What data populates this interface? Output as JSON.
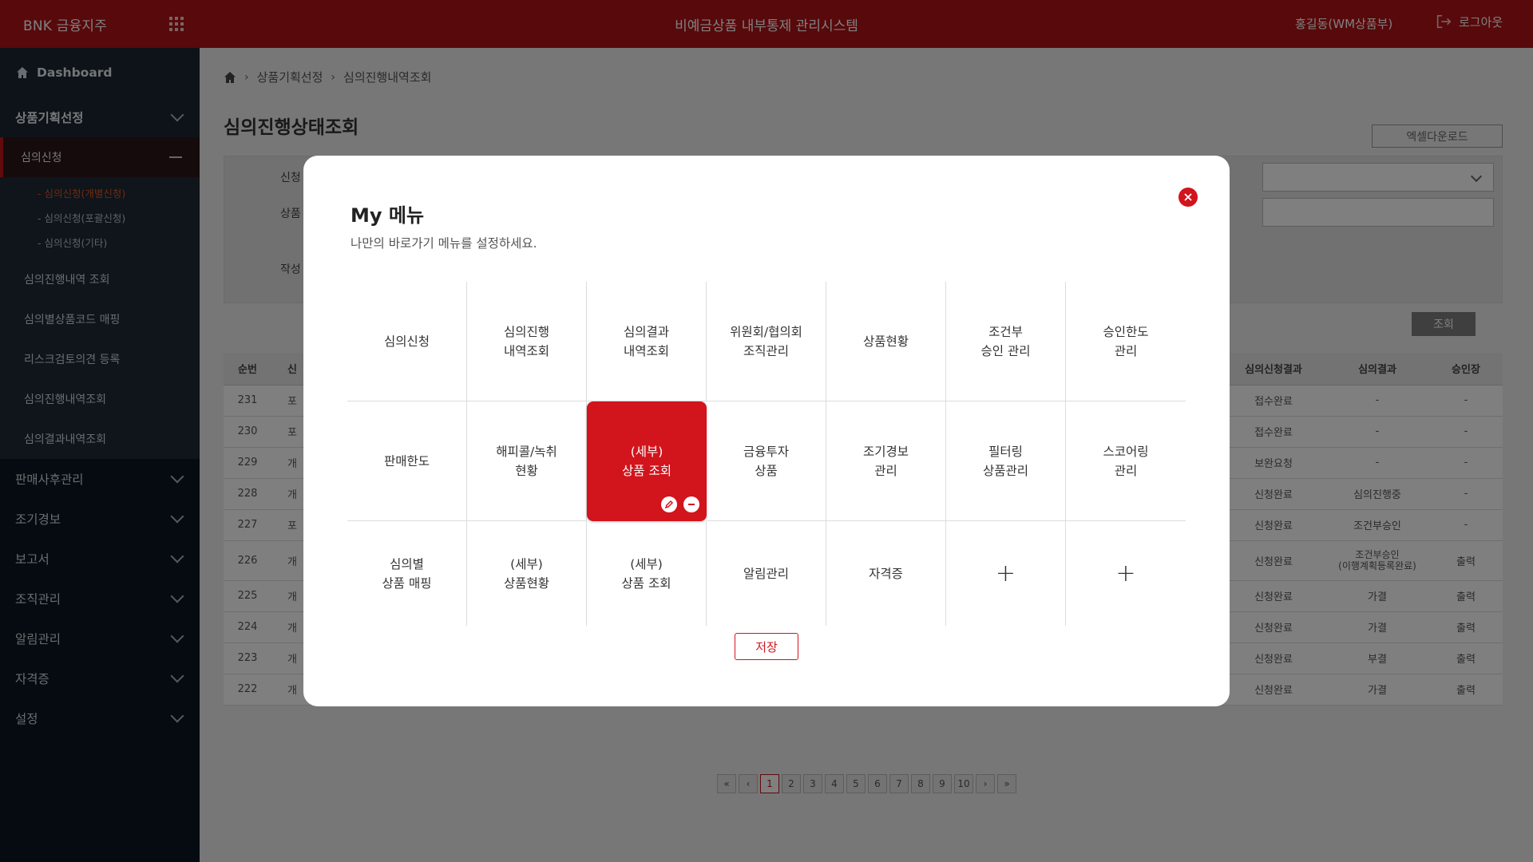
{
  "header": {
    "brand": "BNK 금융지주",
    "system_title": "비예금상품 내부통제 관리시스템",
    "user": "홍길동(WM상품부)",
    "logout_label": "로그아웃"
  },
  "sidebar": {
    "dashboard": "Dashboard",
    "section_open": "상품기획선정",
    "active_sub": "심의신청",
    "sub2": [
      "- 심의신청(개별신청)",
      "- 심의신청(포괄신청)",
      "- 심의신청(기타)"
    ],
    "items": [
      "심의진행내역 조회",
      "심의별상품코드 매핑",
      "리스크검토의견 등록",
      "심의진행내역조회",
      "심의결과내역조회"
    ],
    "sections": [
      "판매사후관리",
      "조기경보",
      "보고서",
      "조직관리",
      "알림관리",
      "자격증",
      "설정"
    ]
  },
  "main": {
    "breadcrumb": [
      "상품기획선정",
      "심의진행내역조회"
    ],
    "title": "심의진행상태조회",
    "excel_button": "엑셀다운로드",
    "search_labels": [
      "신청",
      "상품",
      "작성"
    ],
    "search_button": "조회",
    "table": {
      "headers": [
        "순번",
        "신",
        "심의신청결과",
        "심의결과",
        "승인장"
      ],
      "rows": [
        [
          "231",
          "포",
          "접수완료",
          "-",
          "-"
        ],
        [
          "230",
          "포",
          "접수완료",
          "-",
          "-"
        ],
        [
          "229",
          "개",
          "보완요청",
          "-",
          "-"
        ],
        [
          "228",
          "개",
          "신청완료",
          "심의진행중",
          "-"
        ],
        [
          "227",
          "포",
          "신청완료",
          "조건부승인",
          "-"
        ],
        [
          "226",
          "개",
          "신청완료",
          "조건부승인\n(이행계획등록완료)",
          "출력"
        ],
        [
          "225",
          "개",
          "신청완료",
          "가결",
          "출력"
        ],
        [
          "224",
          "개",
          "신청완료",
          "가결",
          "출력"
        ],
        [
          "223",
          "개",
          "신청완료",
          "부결",
          "출력"
        ],
        [
          "222",
          "개",
          "신청완료",
          "가결",
          "출력"
        ]
      ]
    },
    "pagination": [
      "«",
      "‹",
      "1",
      "2",
      "3",
      "4",
      "5",
      "6",
      "7",
      "8",
      "9",
      "10",
      "›",
      "»"
    ],
    "current_page": "1"
  },
  "modal": {
    "title": "My 메뉴",
    "subtitle": "나만의 바로가기 메뉴를 설정하세요.",
    "cells": [
      "심의신청",
      "심의진행\n내역조회",
      "심의결과\n내역조회",
      "위원회/협의회\n조직관리",
      "상품현황",
      "조건부\n승인 관리",
      "승인한도\n관리",
      "판매한도",
      "해피콜/녹취\n현황",
      "(세부)\n상품 조회",
      "금융투자\n상품",
      "조기경보\n관리",
      "필터링\n상품관리",
      "스코어링\n관리",
      "심의별\n상품 매핑",
      "(세부)\n상품현황",
      "(세부)\n상품 조회",
      "알림관리",
      "자격증",
      "+",
      "+"
    ],
    "selected_index": 9,
    "save_label": "저장",
    "colors": {
      "accent": "#d2141c",
      "header": "#b01217"
    }
  }
}
